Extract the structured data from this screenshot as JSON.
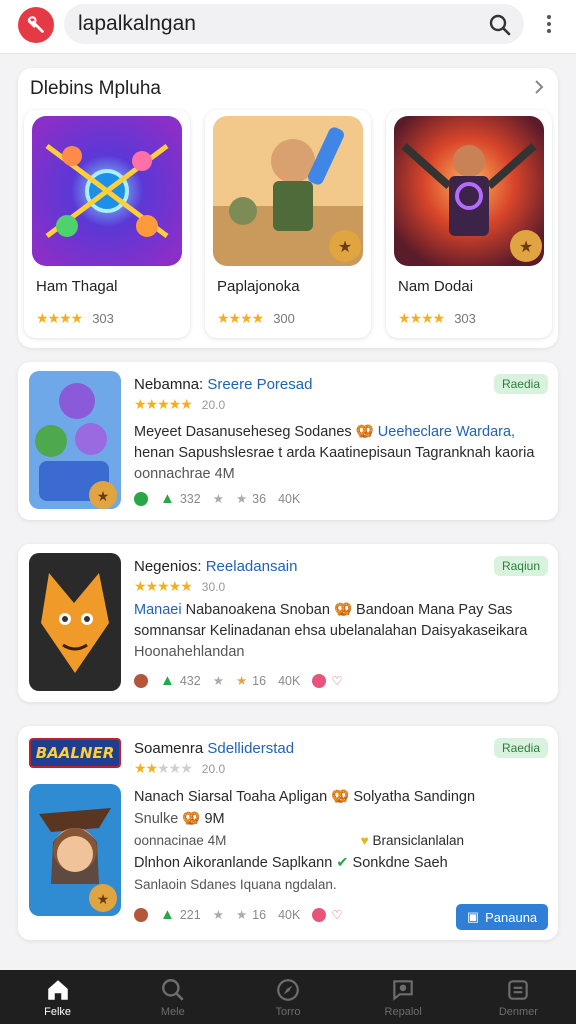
{
  "search": {
    "query": "lapalkalngan"
  },
  "featured": {
    "title": "Dlebins Mpluha",
    "apps": [
      {
        "name": "Ham Thagal",
        "rating": "4.0",
        "count": "303"
      },
      {
        "name": "Paplajonoka",
        "rating": "4.0",
        "count": "300"
      },
      {
        "name": "Nam Dodai",
        "rating": "4.0",
        "count": "303"
      }
    ]
  },
  "apps": [
    {
      "name": "Nebamna:",
      "developer": "Sreere Poresad",
      "badge": "Raedia",
      "rating_count": "20.0",
      "desc1_a": "Meyeet Dasanuseheseg Sodanes",
      "desc1_b": "Ueeheclare Wardara,",
      "desc2": "henan Sapushslesrae t arda Kaatinepisaun Tagranknah kaoria",
      "desc3": "oonnachrae 4M",
      "stats": [
        "332",
        "36",
        "40K"
      ]
    },
    {
      "name": "Negenios:",
      "developer": "Reeladansain",
      "badge": "Raqiun",
      "rating_count": "30.0",
      "desc1_a": "Manaei",
      "desc1_b": "Nabanoakena Snoban",
      "desc1_c": "Bandoan Mana Pay Sas",
      "desc2": "somnansar Kelinadanan ehsa ubelanalahan Daisyakaseikara",
      "desc3": "Hoonahehlandan",
      "stats": [
        "432",
        "16",
        "40K"
      ]
    },
    {
      "name": "Soamenra",
      "developer": "Sdelliderstad",
      "badge": "Raedia",
      "banner": "BAALNER",
      "rating_count": "20.0",
      "desc1": "Nanach Siarsal Toaha Apligan",
      "desc1_b": "Solyatha Sandingn",
      "desc2": "Snulke",
      "desc2_b": "9M",
      "desc3_a": "oonnacinae 4M",
      "desc3_b": "Bransiclanlalan",
      "desc4_a": "Dlnhon Aikoranlande Saplkann",
      "desc4_b": "Sonkdne Saeh",
      "desc5": "Sanlaoin Sdanes Iquana ngdalan.",
      "stats": [
        "221",
        "16",
        "40K"
      ],
      "install": "Panauna"
    }
  ],
  "nav": [
    {
      "label": "Felke"
    },
    {
      "label": "Mele"
    },
    {
      "label": "Torro"
    },
    {
      "label": "Repalol"
    },
    {
      "label": "Denmer"
    }
  ]
}
